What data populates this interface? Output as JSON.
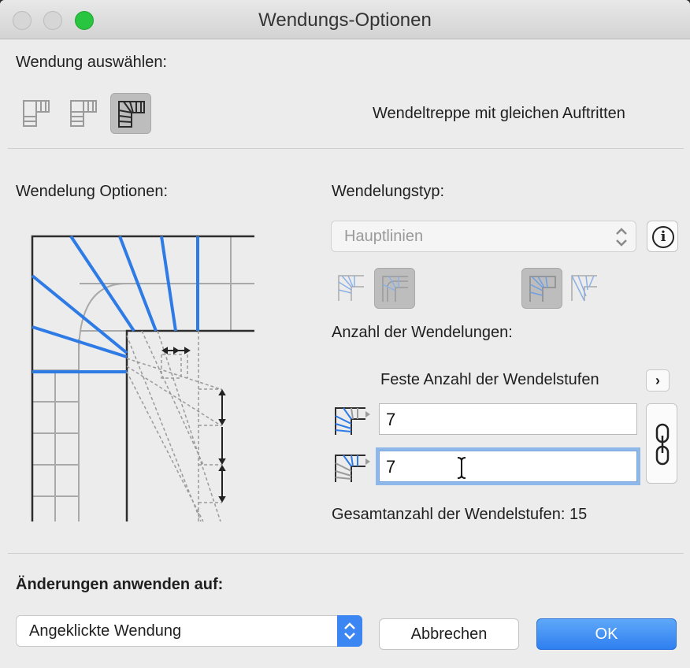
{
  "window": {
    "title": "Wendungs-Optionen"
  },
  "select_turn": {
    "label": "Wendung auswählen:",
    "description": "Wendeltreppe mit gleichen Auftritten",
    "icons": [
      "landing-stair-icon",
      "quarter-landing-stair-icon",
      "winder-stair-icon"
    ],
    "selected_index": 2
  },
  "winding_options": {
    "label": "Wendelung Optionen:"
  },
  "winding_type": {
    "label": "Wendelungstyp:",
    "value": "Hauptlinien",
    "left_icon_group_selected": 1,
    "right_icon_group_selected": 0
  },
  "count": {
    "label": "Anzahl der Wendelungen:",
    "fixed_label": "Feste Anzahl der Wendelstufen",
    "first_value": "7",
    "second_value": "7",
    "total_label": "Gesamtanzahl der Wendelstufen: 15"
  },
  "apply": {
    "label": "Änderungen anwenden auf:",
    "value": "Angeklickte Wendung"
  },
  "buttons": {
    "cancel": "Abbrechen",
    "ok": "OK"
  },
  "colors": {
    "accent": "#3b86f2",
    "stair_lines": "#2f7be6",
    "focus_ring": "#8fb8ea"
  }
}
